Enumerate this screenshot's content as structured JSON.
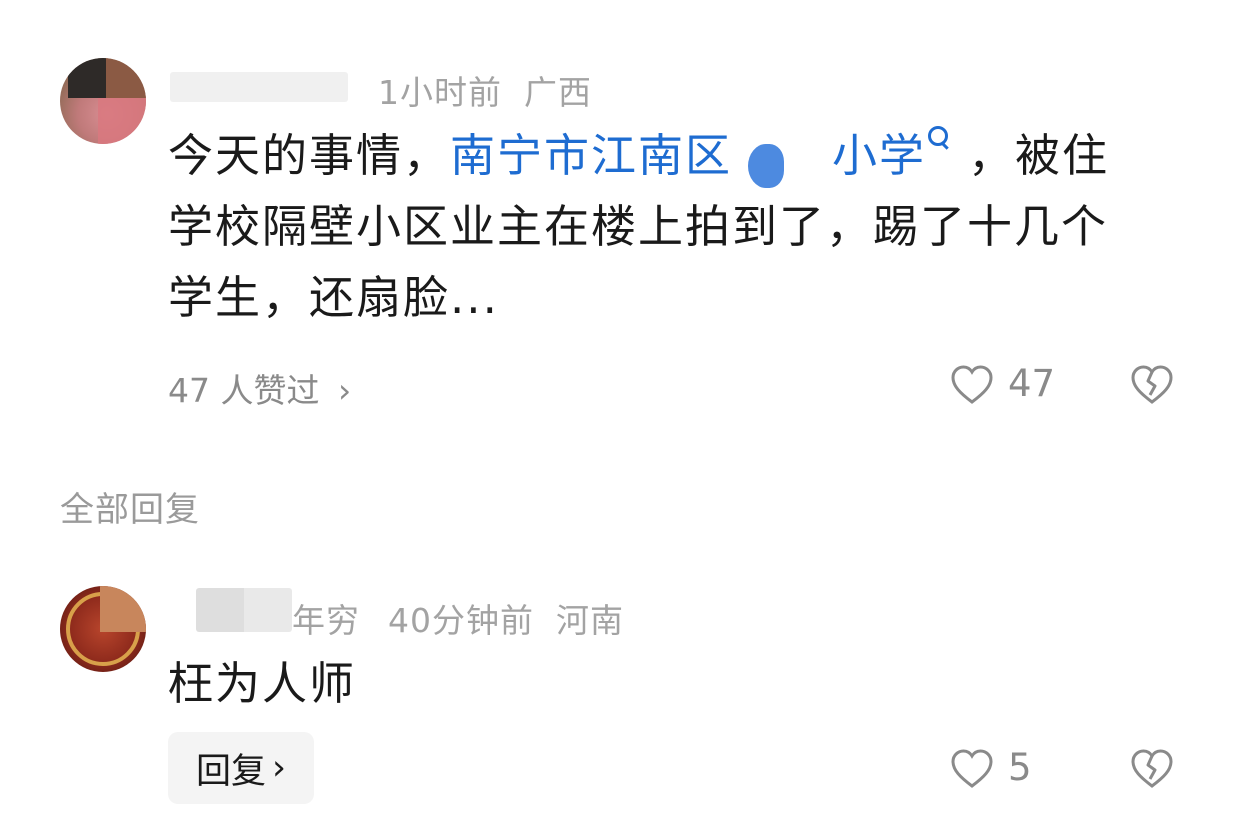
{
  "comment": {
    "time": "1小时前",
    "location": "广西",
    "text_line1_a": "今天的事情，",
    "text_line1_link_a": "南宁市江南区",
    "text_line1_link_b": "小学",
    "text_line1_b": "，被住",
    "text_line2": "学校隔壁小区业主在楼上拍到了，踢了十几个",
    "text_line3": "学生，还扇脸...",
    "liked_by": "47 人赞过",
    "like_count": "47"
  },
  "replies_header": "全部回复",
  "reply": {
    "name_visible": "年穷",
    "time": "40分钟前",
    "location": "河南",
    "text": "枉为人师",
    "reply_button": "回复",
    "like_count": "5"
  },
  "icons": {
    "link_search": "search-icon",
    "like": "heart-outline-icon",
    "dislike": "broken-heart-icon",
    "chevron": "chevron-right-icon"
  },
  "colors": {
    "link": "#1e6cd1",
    "meta": "#a3a3a3",
    "text": "#1a1a1a"
  }
}
